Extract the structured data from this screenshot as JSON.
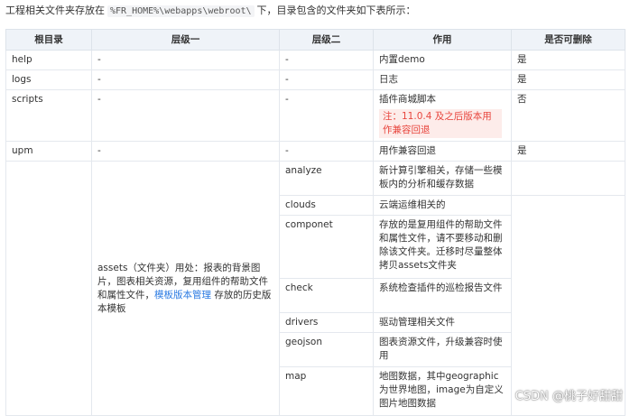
{
  "intro": {
    "before": "工程相关文件夹存放在",
    "path": "%FR_HOME%\\webapps\\webroot\\",
    "after": "下，目录包含的文件夹如下表所示："
  },
  "table": {
    "headers": [
      "根目录",
      "层级一",
      "层级二",
      "作用",
      "是否可删除"
    ],
    "rows": [
      {
        "root": "help",
        "level1": "-",
        "level2": "-",
        "usage": "内置demo",
        "deletable": "是"
      },
      {
        "root": "logs",
        "level1": "-",
        "level2": "-",
        "usage": "日志",
        "deletable": "是"
      },
      {
        "root": "scripts",
        "level1": "-",
        "level2": "-",
        "usage": "插件商城脚本",
        "note": "注：11.0.4 及之后版本用作兼容回退",
        "deletable": "否"
      },
      {
        "root": "upm",
        "level1": "-",
        "level2": "-",
        "usage": "用作兼容回退",
        "deletable": "是"
      }
    ],
    "assets": {
      "description_before": "assets（文件夹）用处：报表的背景图片，图表相关资源，复用组件的帮助文件和属性文件，",
      "link": "模板版本管理",
      "description_after": "存放的历史版本模板",
      "children": [
        {
          "name": "analyze",
          "usage": "新计算引擎相关，存储一些模板内的分析和缓存数据"
        },
        {
          "name": "clouds",
          "usage": "云端运维相关的"
        },
        {
          "name": "componet",
          "usage": "存放的是复用组件的帮助文件和属性文件，请不要移动和删除该文件夹。迁移时尽量整体拷贝assets文件夹"
        },
        {
          "name": "check",
          "usage": "系统检查插件的巡检报告文件"
        },
        {
          "name": "drivers",
          "usage": "驱动管理相关文件"
        },
        {
          "name": "geojson",
          "usage": "图表资源文件，升级兼容时使用"
        },
        {
          "name": "map",
          "usage": "地图数据，其中geographic为世界地图，image为自定义图片地图数据"
        }
      ]
    }
  },
  "watermark": "CSDN @桃子好甜甜"
}
